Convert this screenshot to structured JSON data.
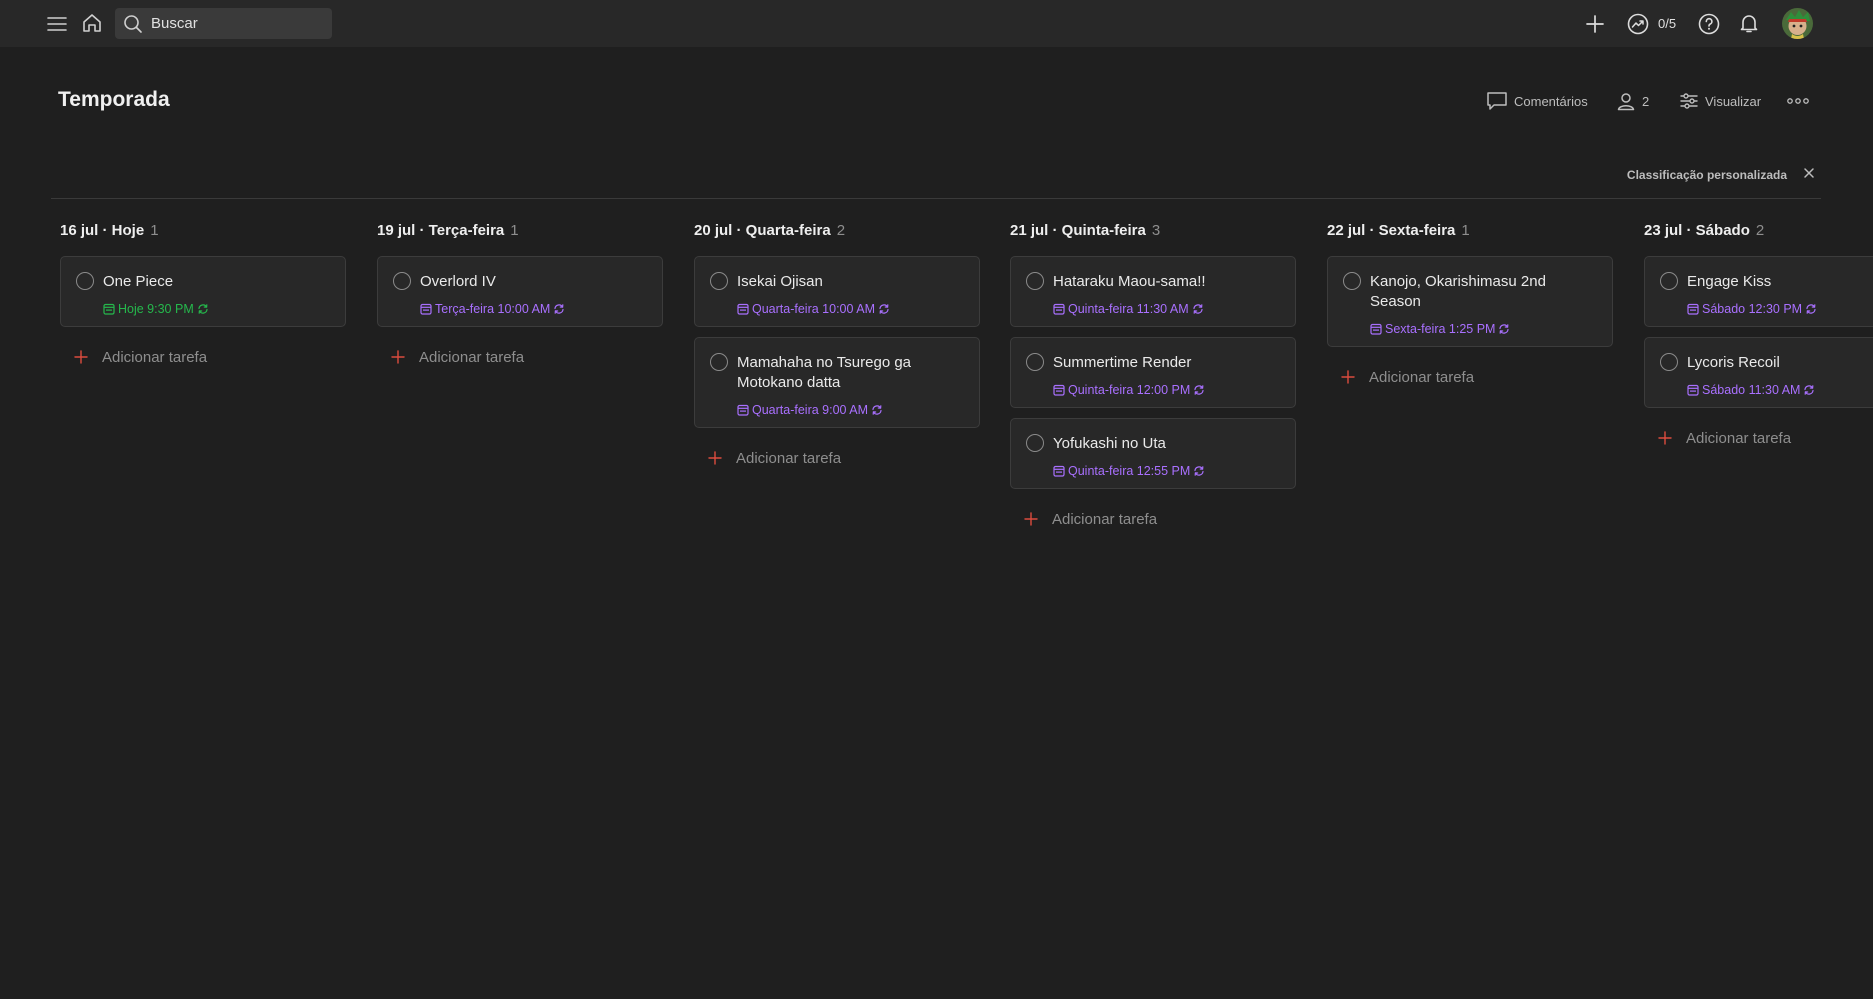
{
  "topbar": {
    "search_placeholder": "Buscar",
    "karma": "0/5"
  },
  "project": {
    "title": "Temporada",
    "actions": {
      "comments": "Comentários",
      "shared_count": "2",
      "view": "Visualizar"
    }
  },
  "sort": {
    "label": "Classificação personalizada"
  },
  "add_task_label": "Adicionar tarefa",
  "columns": [
    {
      "heading": "16 jul · Hoje",
      "count": "1",
      "tasks": [
        {
          "name": "One Piece",
          "due": "Hoje 9:30 PM"
        }
      ]
    },
    {
      "heading": "19 jul · Terça-feira",
      "count": "1",
      "tasks": [
        {
          "name": "Overlord IV",
          "due": "Terça-feira 10:00 AM"
        }
      ]
    },
    {
      "heading": "20 jul · Quarta-feira",
      "count": "2",
      "tasks": [
        {
          "name": "Isekai Ojisan",
          "due": "Quarta-feira 10:00 AM"
        },
        {
          "name": "Mamahaha no Tsurego ga Motokano datta",
          "due": "Quarta-feira 9:00 AM"
        }
      ]
    },
    {
      "heading": "21 jul · Quinta-feira",
      "count": "3",
      "tasks": [
        {
          "name": "Hataraku Maou-sama!!",
          "due": "Quinta-feira 11:30 AM"
        },
        {
          "name": "Summertime Render",
          "due": "Quinta-feira 12:00 PM"
        },
        {
          "name": "Yofukashi no Uta",
          "due": "Quinta-feira 12:55 PM"
        }
      ]
    },
    {
      "heading": "22 jul · Sexta-feira",
      "count": "1",
      "tasks": [
        {
          "name": "Kanojo, Okarishimasu 2nd Season",
          "due": "Sexta-feira 1:25 PM"
        }
      ]
    },
    {
      "heading": "23 jul · Sábado",
      "count": "2",
      "tasks": [
        {
          "name": "Engage Kiss",
          "due": "Sábado 12:30 PM"
        },
        {
          "name": "Lycoris Recoil",
          "due": "Sábado 11:30 AM"
        }
      ]
    }
  ],
  "colors": {
    "background": "#1f1f1f",
    "today_due": "#25b84c",
    "future_due": "#a970ff",
    "add_plus": "#dc4c3e"
  },
  "icons": [
    "menu-icon",
    "home-icon",
    "search-icon",
    "plus-icon",
    "productivity-icon",
    "help-icon",
    "bell-icon",
    "comment-icon",
    "person-icon",
    "sliders-icon",
    "more-icon",
    "close-icon",
    "calendar-icon",
    "recurring-icon"
  ]
}
